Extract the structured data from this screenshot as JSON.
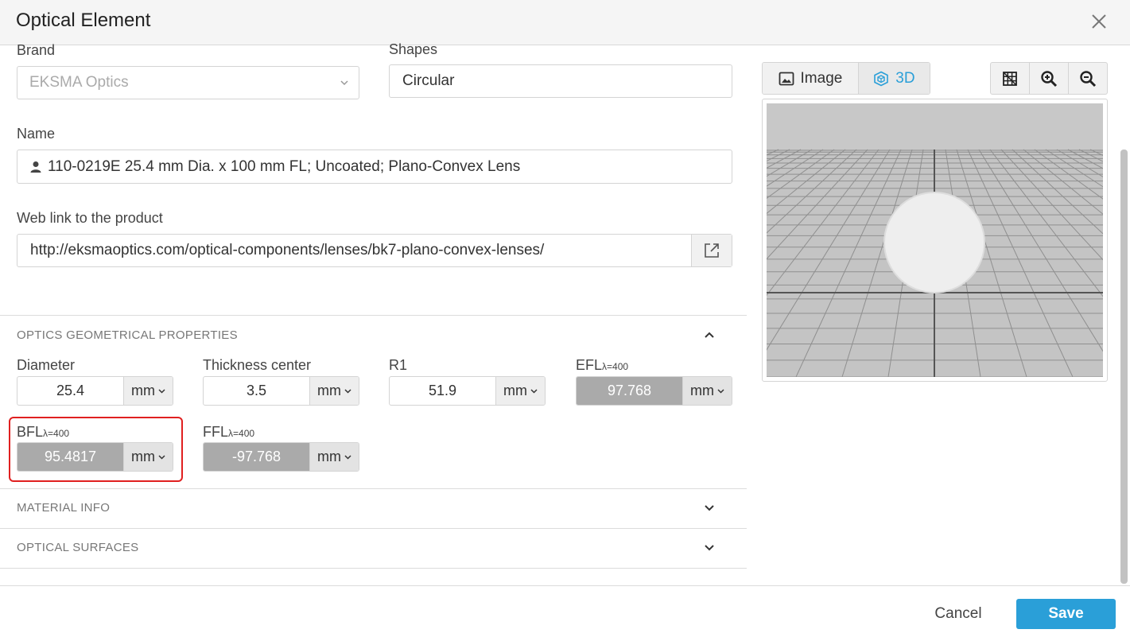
{
  "dialog": {
    "title": "Optical Element"
  },
  "brand": {
    "label": "Brand",
    "value": "EKSMA Optics"
  },
  "shapes": {
    "label": "Shapes",
    "value": "Circular"
  },
  "name": {
    "label": "Name",
    "value": "110-0219E 25.4 mm Dia. x 100 mm FL; Uncoated; Plano-Convex Lens"
  },
  "weblink": {
    "label": "Web link to the product",
    "value": "http://eksmaoptics.com/optical-components/lenses/bk7-plano-convex-lenses/"
  },
  "geometry": {
    "section_title": "OPTICS GEOMETRICAL PROPERTIES",
    "fields": [
      {
        "label": "Diameter",
        "value": "25.4",
        "unit": "mm"
      },
      {
        "label": "Thickness center",
        "value": "3.5",
        "unit": "mm"
      },
      {
        "label": "R1",
        "value": "51.9",
        "unit": "mm"
      },
      {
        "label": "EFL",
        "subscript": "λ=400",
        "value": "97.768",
        "unit": "mm"
      },
      {
        "label": "BFL",
        "subscript": "λ=400",
        "value": "95.4817",
        "unit": "mm"
      },
      {
        "label": "FFL",
        "subscript": "λ=400",
        "value": "-97.768",
        "unit": "mm"
      }
    ]
  },
  "material": {
    "section_title": "MATERIAL INFO"
  },
  "surfaces": {
    "section_title": "OPTICAL SURFACES"
  },
  "viewer": {
    "tabs": [
      {
        "label": "Image"
      },
      {
        "label": "3D",
        "active": true
      }
    ]
  },
  "colors": {
    "accent": "#2a9fd8",
    "highlight": "#e02020",
    "computed_field": "#aaaaaa"
  },
  "footer": {
    "cancel_label": "Cancel",
    "save_label": "Save"
  }
}
